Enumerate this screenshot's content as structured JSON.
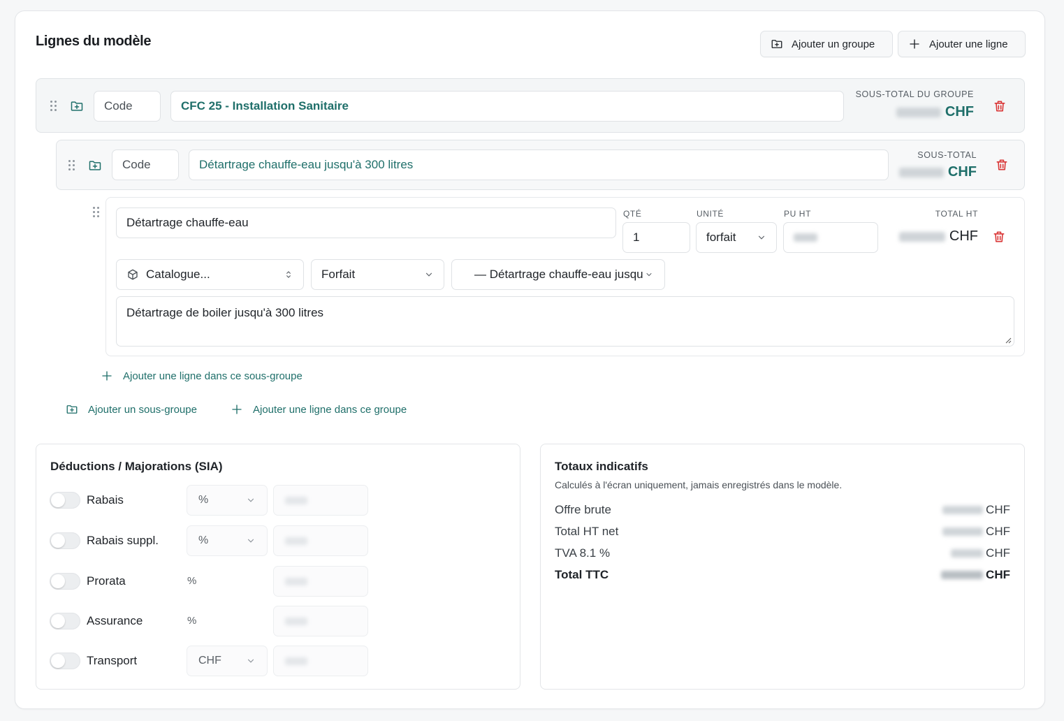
{
  "section": {
    "title": "Lignes du modèle",
    "add_group_label": "Ajouter un groupe",
    "add_line_label": "Ajouter une ligne"
  },
  "group": {
    "code_placeholder": "Code",
    "name": "CFC 25 - Installation Sanitaire",
    "subtotal_label": "SOUS-TOTAL DU GROUPE",
    "subtotal_currency": "CHF"
  },
  "subgroup": {
    "code_placeholder": "Code",
    "name": "Détartrage chauffe-eau jusqu'à 300 litres",
    "subtotal_label": "SOUS-TOTAL",
    "subtotal_currency": "CHF"
  },
  "line": {
    "title": "Détartrage chauffe-eau",
    "qty_label": "QTÉ",
    "qty_value": "1",
    "unit_label": "UNITÉ",
    "unit_value": "forfait",
    "pu_label": "PU HT",
    "total_label": "TOTAL HT",
    "total_currency": "CHF",
    "catalogue_label": "Catalogue...",
    "type_value": "Forfait",
    "article_value": "— Détartrage chauffe-eau jusqu",
    "description": "Détartrage de boiler jusqu'à 300 litres"
  },
  "actions": {
    "add_line_subgroup": "Ajouter une ligne dans ce sous-groupe",
    "add_subgroup": "Ajouter un sous-groupe",
    "add_line_group": "Ajouter une ligne dans ce groupe"
  },
  "deductions": {
    "title": "Déductions / Majorations (SIA)",
    "items": [
      {
        "label": "Rabais",
        "unit": "%"
      },
      {
        "label": "Rabais suppl.",
        "unit": "%"
      },
      {
        "label": "Prorata",
        "unit": "%"
      },
      {
        "label": "Assurance",
        "unit": "%"
      },
      {
        "label": "Transport",
        "unit": "CHF"
      }
    ]
  },
  "totals": {
    "title": "Totaux indicatifs",
    "subtitle": "Calculés à l'écran uniquement, jamais enregistrés dans le modèle.",
    "rows": [
      {
        "label": "Offre brute",
        "currency": "CHF"
      },
      {
        "label": "Total HT net",
        "currency": "CHF"
      },
      {
        "label": "TVA 8.1 %",
        "currency": "CHF"
      },
      {
        "label": "Total TTC",
        "currency": "CHF"
      }
    ]
  },
  "colors": {
    "accent": "#1f6f6a",
    "danger": "#d93434"
  }
}
